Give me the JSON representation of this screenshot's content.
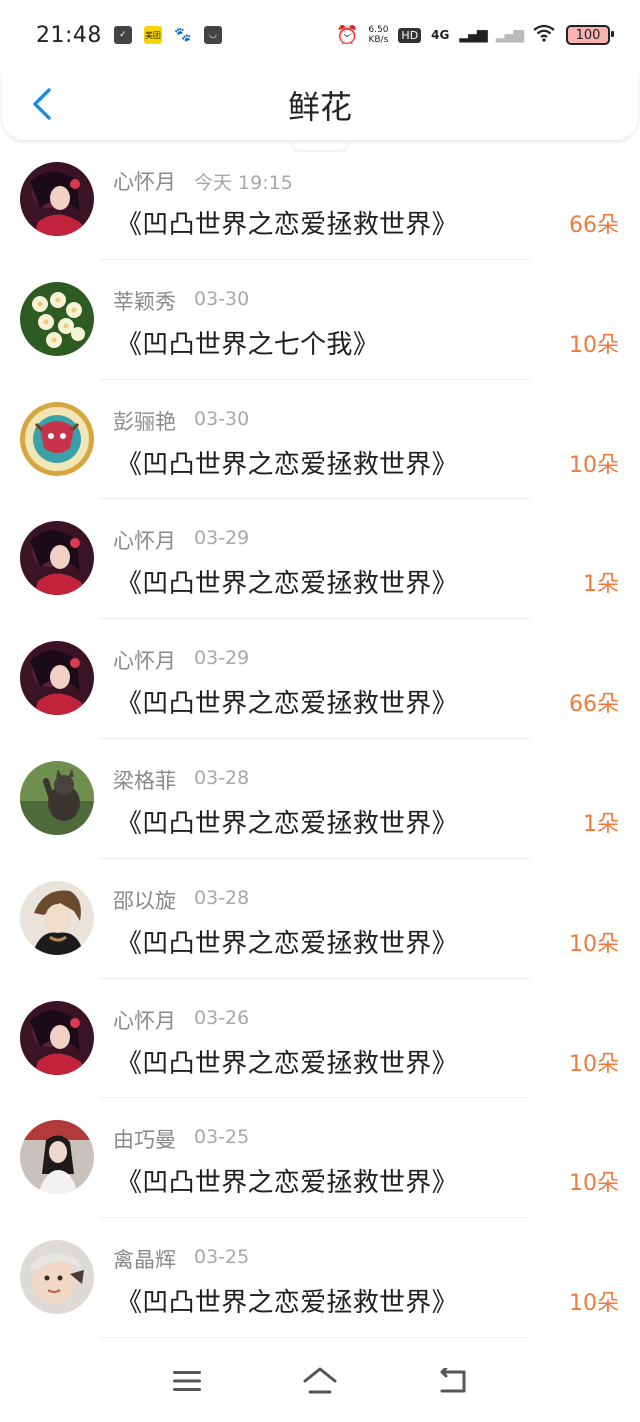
{
  "status": {
    "time": "21:48",
    "app_badge_label": "美团",
    "net_speed_value": "6.50",
    "net_speed_unit": "KB/s",
    "network_label": "4G",
    "hd_label": "HD",
    "battery": "100"
  },
  "header": {
    "title": "鲜花"
  },
  "colors": {
    "accent": "#ee7a3c",
    "back": "#1e8fe0"
  },
  "items": [
    {
      "name": "心怀月",
      "time": "今天 19:15",
      "book": "《凹凸世界之恋爱拯救世界》",
      "amount": "66朵",
      "avatar": "anime-girl"
    },
    {
      "name": "莘颖秀",
      "time": "03-30",
      "book": "《凹凸世界之七个我》",
      "amount": "10朵",
      "avatar": "white-flowers"
    },
    {
      "name": "彭骊艳",
      "time": "03-30",
      "book": "《凹凸世界之恋爱拯救世界》",
      "amount": "10朵",
      "avatar": "ox-emblem"
    },
    {
      "name": "心怀月",
      "time": "03-29",
      "book": "《凹凸世界之恋爱拯救世界》",
      "amount": "1朵",
      "avatar": "anime-girl"
    },
    {
      "name": "心怀月",
      "time": "03-29",
      "book": "《凹凸世界之恋爱拯救世界》",
      "amount": "66朵",
      "avatar": "anime-girl"
    },
    {
      "name": "梁格菲",
      "time": "03-28",
      "book": "《凹凸世界之恋爱拯救世界》",
      "amount": "1朵",
      "avatar": "cat-photo"
    },
    {
      "name": "邵以旋",
      "time": "03-28",
      "book": "《凹凸世界之恋爱拯救世界》",
      "amount": "10朵",
      "avatar": "anime-boy"
    },
    {
      "name": "心怀月",
      "time": "03-26",
      "book": "《凹凸世界之恋爱拯救世界》",
      "amount": "10朵",
      "avatar": "anime-girl"
    },
    {
      "name": "由巧曼",
      "time": "03-25",
      "book": "《凹凸世界之恋爱拯救世界》",
      "amount": "10朵",
      "avatar": "girl-photo"
    },
    {
      "name": "禽晶辉",
      "time": "03-25",
      "book": "《凹凸世界之恋爱拯救世界》",
      "amount": "10朵",
      "avatar": "baby-photo"
    }
  ]
}
